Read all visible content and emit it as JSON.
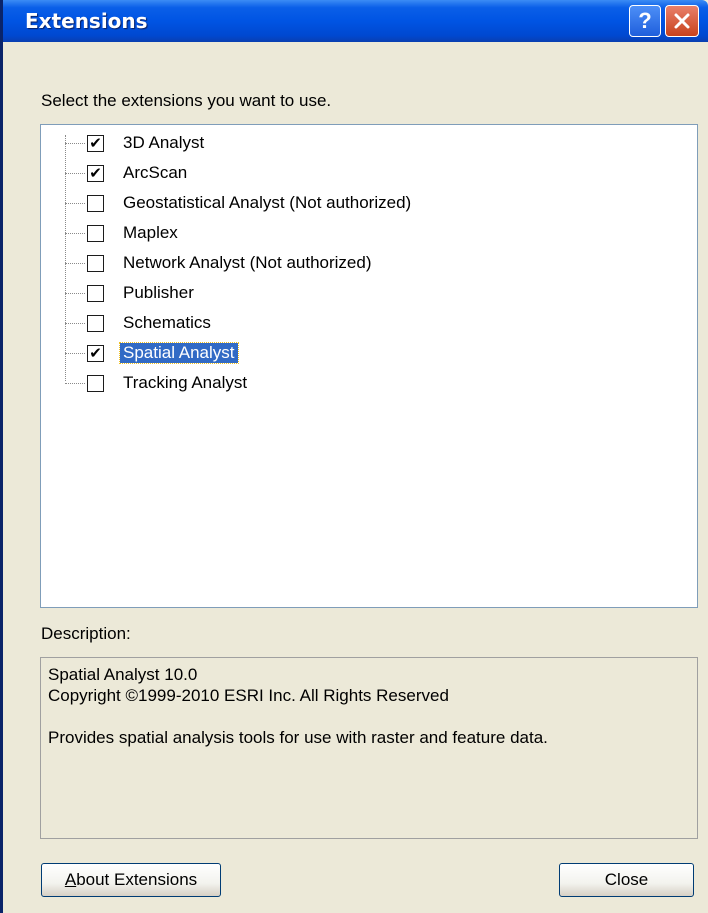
{
  "window": {
    "title": "Extensions",
    "help_glyph": "?",
    "close_glyph": "✕"
  },
  "prompt": "Select the extensions you want to use.",
  "extensions": [
    {
      "label": "3D Analyst",
      "checked": true,
      "selected": false
    },
    {
      "label": "ArcScan",
      "checked": true,
      "selected": false
    },
    {
      "label": "Geostatistical Analyst (Not authorized)",
      "checked": false,
      "selected": false
    },
    {
      "label": "Maplex",
      "checked": false,
      "selected": false
    },
    {
      "label": "Network Analyst (Not authorized)",
      "checked": false,
      "selected": false
    },
    {
      "label": "Publisher",
      "checked": false,
      "selected": false
    },
    {
      "label": "Schematics",
      "checked": false,
      "selected": false
    },
    {
      "label": "Spatial Analyst",
      "checked": true,
      "selected": true
    },
    {
      "label": "Tracking Analyst",
      "checked": false,
      "selected": false
    }
  ],
  "description": {
    "label": "Description:",
    "lines": [
      "Spatial Analyst 10.0",
      "Copyright ©1999-2010 ESRI Inc. All Rights Reserved",
      "",
      "Provides spatial analysis tools for use with raster and feature data."
    ]
  },
  "buttons": {
    "about": "About Extensions",
    "close": "Close"
  },
  "colors": {
    "titlebar": "#0054e3",
    "selection": "#316ac5",
    "dialog_bg": "#ece9d8"
  }
}
